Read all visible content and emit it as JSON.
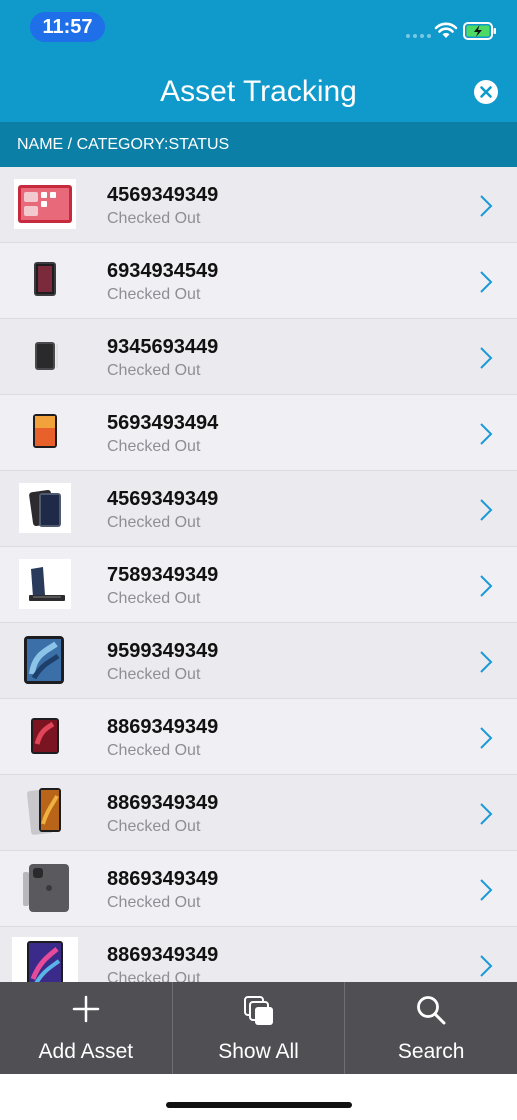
{
  "status_bar": {
    "time": "11:57"
  },
  "header": {
    "title": "Asset Tracking"
  },
  "column_header": "NAME / CATEGORY:STATUS",
  "assets": [
    {
      "number": "4569349349",
      "status": "Checked Out",
      "thumb": "ipad-pink-icon"
    },
    {
      "number": "6934934549",
      "status": "Checked Out",
      "thumb": "ipad-dark-icon"
    },
    {
      "number": "9345693449",
      "status": "Checked Out",
      "thumb": "ipad-gray-icon"
    },
    {
      "number": "5693493494",
      "status": "Checked Out",
      "thumb": "ipad-orange-icon"
    },
    {
      "number": "4569349349",
      "status": "Checked Out",
      "thumb": "ipad-air-icon"
    },
    {
      "number": "7589349349",
      "status": "Checked Out",
      "thumb": "ipad-keyboard-icon"
    },
    {
      "number": "9599349349",
      "status": "Checked Out",
      "thumb": "ipad-air-blue-icon"
    },
    {
      "number": "8869349349",
      "status": "Checked Out",
      "thumb": "ipad-pro-red-icon"
    },
    {
      "number": "8869349349",
      "status": "Checked Out",
      "thumb": "ipad-pro-silver-icon"
    },
    {
      "number": "8869349349",
      "status": "Checked Out",
      "thumb": "ipad-pro-back-icon"
    },
    {
      "number": "8869349349",
      "status": "Checked Out",
      "thumb": "ipad-pro-purple-icon"
    }
  ],
  "tabs": {
    "add": "Add Asset",
    "show_all": "Show All",
    "search": "Search"
  },
  "colors": {
    "header": "#0f9acb",
    "column_header": "#0c7fa6",
    "accent": "#1a9ad6",
    "tabbar": "#4f4f54"
  }
}
